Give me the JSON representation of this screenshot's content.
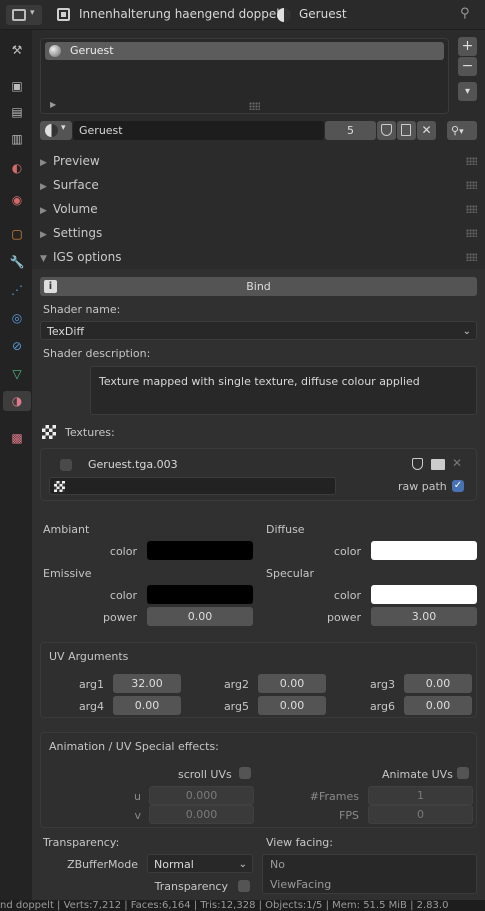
{
  "header": {
    "material_slot_object": "Innenhalterung haengend doppelt",
    "material_name": "Geruest"
  },
  "material_list": {
    "items": [
      "Geruest"
    ],
    "add_symbol": "+",
    "remove_symbol": "−"
  },
  "material_selector": {
    "name": "Geruest",
    "user_count": "5"
  },
  "panels": {
    "preview": "Preview",
    "surface": "Surface",
    "volume": "Volume",
    "settings": "Settings",
    "igs": "IGS options"
  },
  "igs": {
    "bind_label": "Bind",
    "shader_name_label": "Shader name:",
    "shader_name_value": "TexDiff",
    "shader_desc_label": "Shader description:",
    "shader_desc_value": "Texture mapped with single texture, diffuse colour applied",
    "textures_label": "Textures:",
    "texture_name": "Geruest.tga.003",
    "texture_path": "",
    "raw_path_label": "raw path",
    "raw_path_checked": true
  },
  "colors": {
    "ambiant_label": "Ambiant",
    "ambiant_color_label": "color",
    "ambiant_color": "#000000",
    "diffuse_label": "Diffuse",
    "diffuse_color_label": "color",
    "diffuse_color": "#ffffff",
    "emissive_label": "Emissive",
    "emissive_color_label": "color",
    "emissive_color": "#000000",
    "emissive_power_label": "power",
    "emissive_power": "0.00",
    "specular_label": "Specular",
    "specular_color_label": "color",
    "specular_color": "#ffffff",
    "specular_power_label": "power",
    "specular_power": "3.00"
  },
  "uv_args": {
    "title": "UV Arguments",
    "args": [
      {
        "label": "arg1",
        "value": "32.00"
      },
      {
        "label": "arg2",
        "value": "0.00"
      },
      {
        "label": "arg3",
        "value": "0.00"
      },
      {
        "label": "arg4",
        "value": "0.00"
      },
      {
        "label": "arg5",
        "value": "0.00"
      },
      {
        "label": "arg6",
        "value": "0.00"
      }
    ]
  },
  "anim": {
    "title": "Animation / UV Special effects:",
    "scroll_label": "scroll UVs",
    "animate_label": "Animate UVs",
    "u_label": "u",
    "u_value": "0.000",
    "v_label": "v",
    "v_value": "0.000",
    "frames_label": "#Frames",
    "frames_value": "1",
    "fps_label": "FPS",
    "fps_value": "0"
  },
  "transparency": {
    "title": "Transparency:",
    "zbuffer_label": "ZBufferMode",
    "zbuffer_value": "Normal",
    "transparency_label": "Transparency",
    "view_facing_label": "View facing:",
    "view_facing_options": [
      "No",
      "ViewFacing"
    ]
  },
  "status_bar": "nd doppelt | Verts:7,212 | Faces:6,164 | Tris:12,328 | Objects:1/5 | Mem: 51.5 MiB | 2.83.0"
}
